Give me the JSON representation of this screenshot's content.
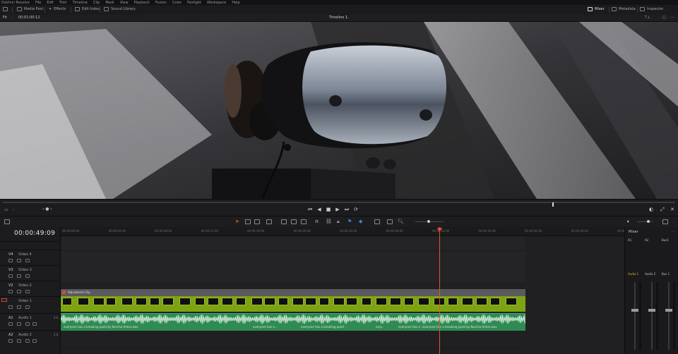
{
  "menu": [
    "DaVinci Resolve",
    "File",
    "Edit",
    "Trim",
    "Timeline",
    "Clip",
    "Mark",
    "View",
    "Playback",
    "Fusion",
    "Color",
    "Fairlight",
    "Workspace",
    "Help"
  ],
  "toolbar": {
    "media_pool": "Media Pool",
    "effects": "Effects",
    "edit_index": "Edit Index",
    "sound_library": "Sound Library",
    "mixer": "Mixer",
    "metadata": "Metadata",
    "inspector": "Inspector"
  },
  "viewer": {
    "zoom": "Fit",
    "source_timecode": "00:01:00:12",
    "timeline_name": "Timeline 1"
  },
  "timeline": {
    "timecode": "00:00:49:09",
    "ruler": [
      "00:00:00:00",
      "00:00:04:00",
      "00:00:08:00",
      "00:00:12:00",
      "00:00:16:00",
      "00:00:20:00",
      "00:00:24:00",
      "00:00:28:00",
      "00:00:32:00",
      "00:00:36:00",
      "00:00:40:00",
      "00:00:44:00",
      "00:00:48:00",
      "00:00:52:00"
    ],
    "tracks": [
      {
        "id": "V4",
        "name": "Video 4"
      },
      {
        "id": "V3",
        "name": "Video 3"
      },
      {
        "id": "V2",
        "name": "Video 2"
      },
      {
        "id": "V1",
        "name": "Video 1"
      },
      {
        "id": "A1",
        "name": "Audio 1",
        "ch": "2.0"
      },
      {
        "id": "A2",
        "name": "Audio 2",
        "ch": "2.0"
      }
    ],
    "adjustment_clip": "Adjustment Clip",
    "audio_clip_labels": [
      "everyone has a breaking point by Koncha Anton.wav",
      "everyone has a ..",
      "everyone has a breaking point ..",
      "evry..",
      "everyone has a ..",
      "everyone has a breaking point by Koncha Anton.wav"
    ]
  },
  "mixer": {
    "title": "Mixer",
    "channels": [
      {
        "name": "A1",
        "label": "Audio 1"
      },
      {
        "name": "A2",
        "label": "Audio 2"
      },
      {
        "name": "Bus1",
        "label": "Bus 1"
      }
    ]
  },
  "colors": {
    "accent": "#e3542e",
    "video_clip": "#7ea312",
    "audio_clip": "#2f8a53"
  }
}
